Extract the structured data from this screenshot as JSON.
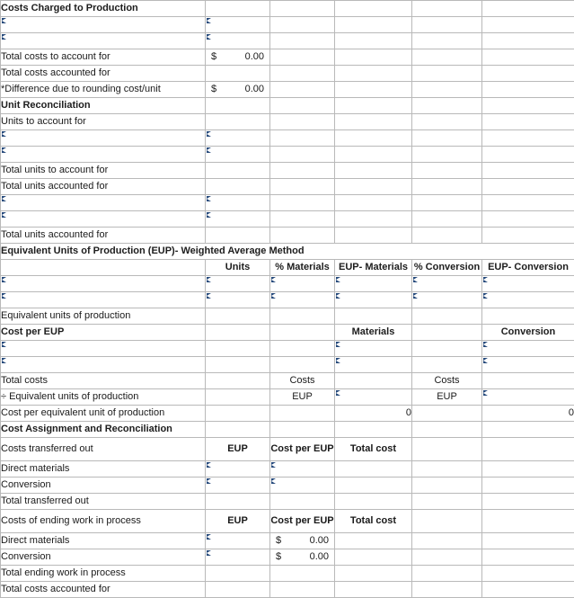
{
  "sections": {
    "costs_charged": {
      "title": "Costs Charged to Production",
      "rows": {
        "total_to_account": "Total costs to account for",
        "total_accounted": "Total costs accounted for",
        "difference": "*Difference due to rounding cost/unit"
      },
      "values": {
        "total_to_account_symbol": "$",
        "total_to_account_amount": "0.00",
        "difference_symbol": "$",
        "difference_amount": "0.00"
      }
    },
    "unit_reconciliation": {
      "title": "Unit Reconciliation",
      "rows": {
        "units_to_account": "Units to account for",
        "total_units_to_account": "Total units to account for",
        "total_units_accounted_top": "Total units accounted for",
        "total_units_accounted_bottom": "Total units accounted for"
      }
    },
    "eup": {
      "title": "Equivalent Units of Production (EUP)- Weighted Average Method",
      "columns": {
        "units": "Units",
        "pct_materials": "% Materials",
        "eup_materials": "EUP- Materials",
        "pct_conversion": "% Conversion",
        "eup_conversion": "EUP- Conversion"
      },
      "rows": {
        "equivalent_units": "Equivalent units of production"
      }
    },
    "cost_per_eup": {
      "title": "Cost per EUP",
      "columns": {
        "materials": "Materials",
        "conversion": "Conversion"
      },
      "rows": {
        "total_costs": "Total costs",
        "divided_by_eup": "÷ Equivalent units of production",
        "cost_per_unit": "Cost per equivalent unit of production"
      },
      "values": {
        "total_costs_materials_label": "Costs",
        "total_costs_conversion_label": "Costs",
        "divide_materials_label": "EUP",
        "divide_conversion_label": "EUP",
        "cost_per_unit_materials": "0",
        "cost_per_unit_conversion": "0"
      }
    },
    "cost_assignment": {
      "title": "Cost Assignment and Reconciliation",
      "transferred_out": {
        "label": "Costs transferred out",
        "col_eup": "EUP",
        "col_cost_per_eup": "Cost per\nEUP",
        "col_total_cost": "Total cost",
        "direct_materials": "Direct materials",
        "conversion": "Conversion",
        "total": "Total transferred out"
      },
      "ending_wip": {
        "label": "Costs of ending work in process",
        "col_eup": "EUP",
        "col_cost_per_eup": "Cost per\nEUP",
        "col_total_cost": "Total cost",
        "direct_materials": "Direct materials",
        "direct_materials_symbol": "$",
        "direct_materials_amount": "0.00",
        "conversion": "Conversion",
        "conversion_symbol": "$",
        "conversion_amount": "0.00",
        "total": "Total ending work in process"
      },
      "total_costs_accounted": "Total costs accounted for"
    }
  },
  "colors": {
    "header_blue": "#7fabdd",
    "input_border": "#6f9fd0",
    "highlight_yellow": "#ffffb0"
  }
}
